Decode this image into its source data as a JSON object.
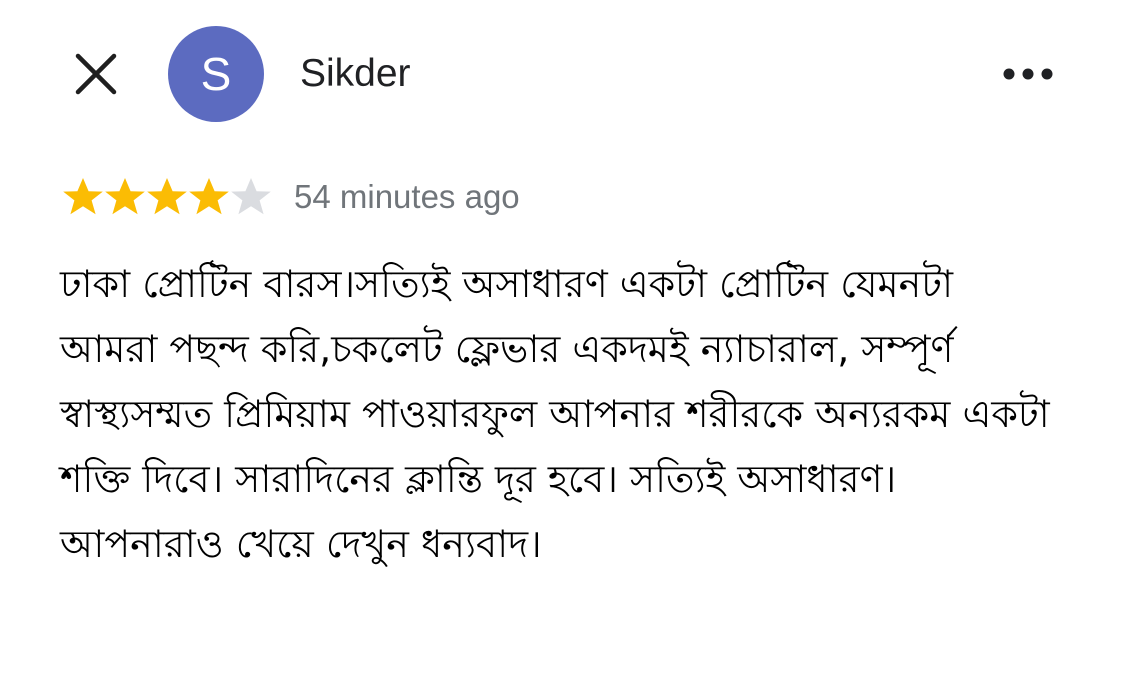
{
  "header": {
    "avatar_initial": "S",
    "avatar_color": "#5c6bc0",
    "username": "Sikder",
    "close_icon": "close-icon",
    "more_icon": "more-horizontal-icon"
  },
  "review": {
    "rating": 4,
    "max_rating": 5,
    "star_filled_color": "#fbbc04",
    "star_empty_color": "#dadce0",
    "timestamp": "54 minutes ago",
    "text": "ঢাকা প্রোটিন বারস।সত্যিই অসাধারণ একটা প্রোটিন যেমনটা আমরা পছন্দ করি,চকলেট ফ্লেভার একদমই ন্যাচারাল, সম্পূর্ণ স্বাস্থ্যসম্মত প্রিমিয়াম পাওয়ারফুল আপনার শরীরকে অন্যরকম একটা শক্তি দিবে। সারাদিনের ক্লান্তি দূর হবে। সত্যিই অসাধারণ। আপনারাও খেয়ে দেখুন ধন্যবাদ।"
  }
}
